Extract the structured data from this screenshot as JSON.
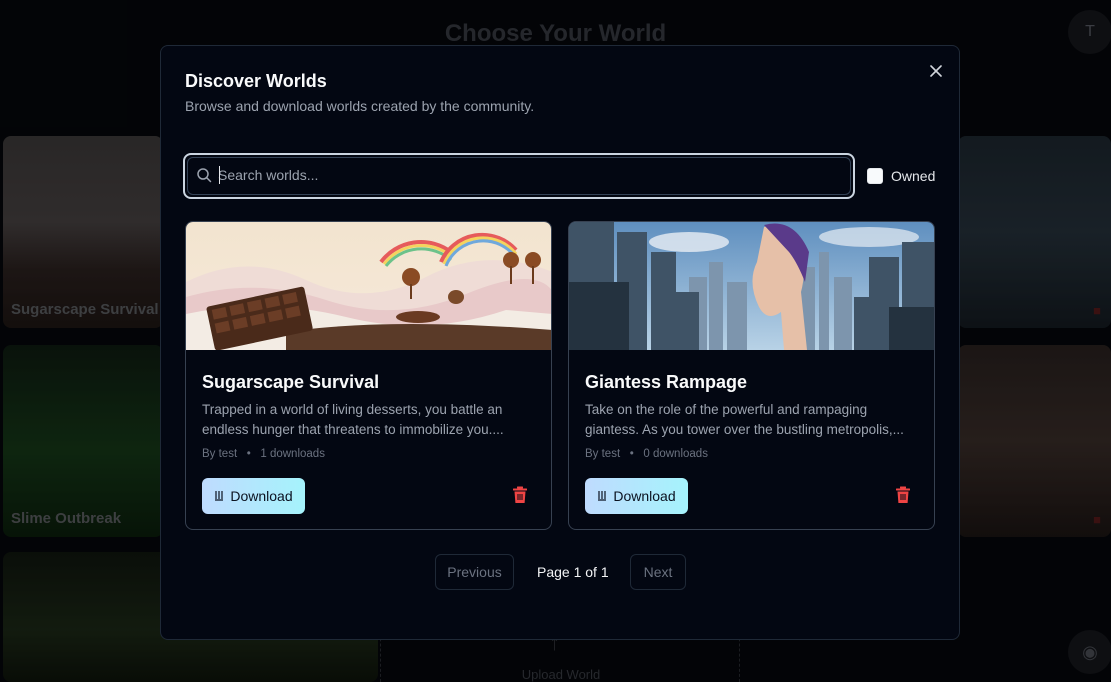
{
  "background": {
    "title": "Choose Your World",
    "avatar_initial": "T",
    "worlds": [
      {
        "label": "Sugarscape Survival"
      },
      {
        "label": "Slime Outbreak"
      }
    ],
    "upload_label": "Upload World"
  },
  "modal": {
    "title": "Discover Worlds",
    "subtitle": "Browse and download worlds created by the community.",
    "close_icon": "close-icon",
    "search": {
      "placeholder": "Search worlds...",
      "value": ""
    },
    "owned_filter": {
      "label": "Owned",
      "checked": false
    },
    "cards": [
      {
        "title": "Sugarscape Survival",
        "description": "Trapped in a world of living desserts, you battle an endless hunger that threatens to immobilize you....",
        "author": "By test",
        "downloads": "1 downloads",
        "download_label": "Download"
      },
      {
        "title": "Giantess Rampage",
        "description": "Take on the role of the powerful and rampaging giantess. As you tower over the bustling metropolis,...",
        "author": "By test",
        "downloads": "0 downloads",
        "download_label": "Download"
      }
    ],
    "pagination": {
      "previous_label": "Previous",
      "page_label": "Page 1 of 1",
      "next_label": "Next"
    }
  },
  "colors": {
    "modal_bg": "#030712",
    "download_gradient_start": "#bfdbfe",
    "download_gradient_end": "#a5f3fc",
    "delete_red": "#ef4444"
  }
}
